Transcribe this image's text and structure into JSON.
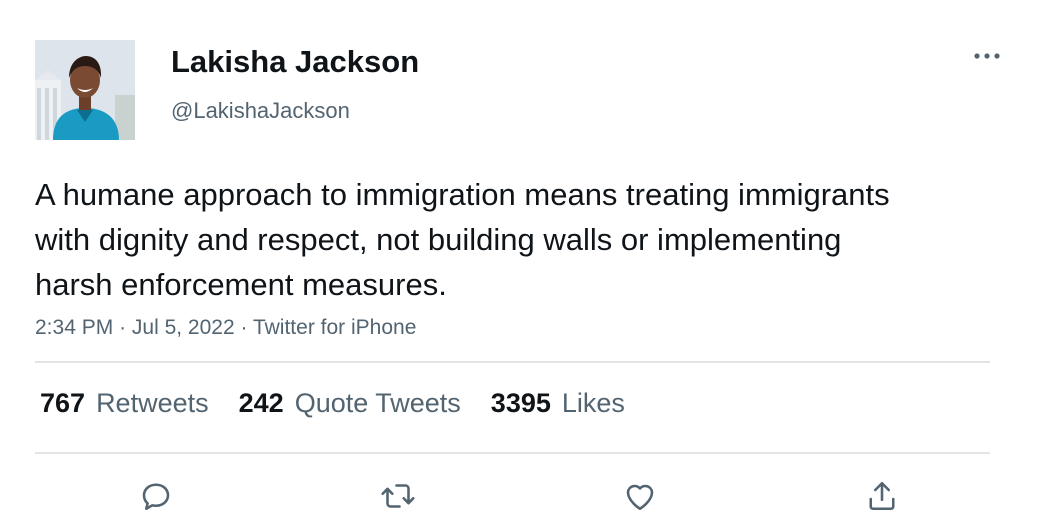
{
  "author": {
    "name": "Lakisha Jackson",
    "handle": "@LakishaJackson",
    "avatar_icon": "profile-photo"
  },
  "tweet": {
    "text": "A humane approach to immigration means treating immigrants with dignity and respect, not building walls or implementing harsh enforcement measures.",
    "time": "2:34 PM",
    "separator": "·",
    "date": "Jul 5, 2022",
    "source": "Twitter for iPhone"
  },
  "stats": [
    {
      "count": "767",
      "label": "Retweets"
    },
    {
      "count": "242",
      "label": "Quote Tweets"
    },
    {
      "count": "3395",
      "label": "Likes"
    }
  ],
  "actions": [
    "reply-icon",
    "retweet-icon",
    "like-icon",
    "share-icon"
  ],
  "colors": {
    "text": "#0f1419",
    "secondary": "#536471",
    "divider": "#e1e5e8",
    "icon": "#536471"
  }
}
